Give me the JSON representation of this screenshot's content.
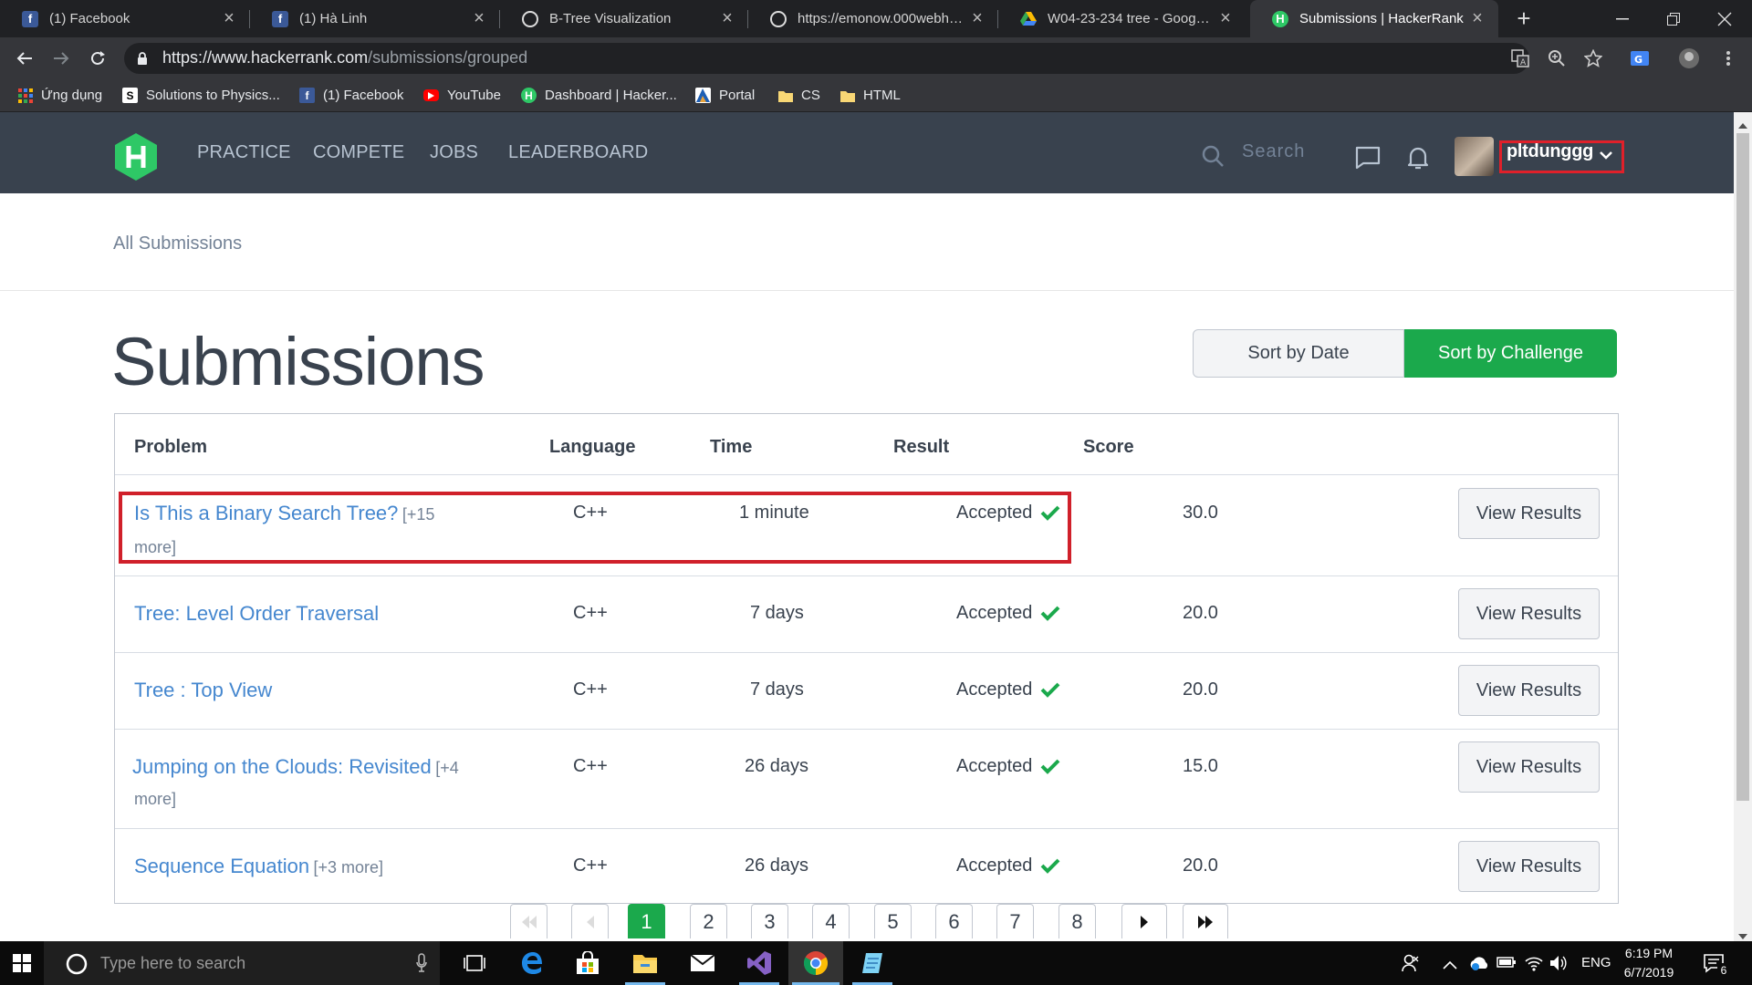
{
  "browser": {
    "tabs": [
      {
        "title": "(1) Facebook",
        "icon": "facebook-icon"
      },
      {
        "title": "(1) Hà Linh",
        "icon": "facebook-icon"
      },
      {
        "title": "B-Tree Visualization",
        "icon": "globe-icon"
      },
      {
        "title": "https://emonow.000webhost",
        "icon": "globe-icon"
      },
      {
        "title": "W04-23-234 tree - Google D",
        "icon": "google-drive-icon"
      },
      {
        "title": "Submissions | HackerRank",
        "icon": "hackerrank-icon",
        "active": true
      }
    ],
    "url_host": "https://www.hackerrank.com",
    "url_path": "/submissions/grouped",
    "bookmarks": [
      {
        "label": "Ứng dụng",
        "icon": "apps-grid-icon"
      },
      {
        "label": "Solutions to Physics...",
        "icon": "scribd-icon"
      },
      {
        "label": "(1) Facebook",
        "icon": "facebook-icon"
      },
      {
        "label": "YouTube",
        "icon": "youtube-icon"
      },
      {
        "label": "Dashboard | Hacker...",
        "icon": "hackerrank-icon"
      },
      {
        "label": "Portal",
        "icon": "portal-icon"
      },
      {
        "label": "CS",
        "icon": "folder-icon"
      },
      {
        "label": "HTML",
        "icon": "folder-icon"
      }
    ]
  },
  "nav": {
    "links": [
      "PRACTICE",
      "COMPETE",
      "JOBS",
      "LEADERBOARD"
    ],
    "search_placeholder": "Search",
    "username": "pltdunggg"
  },
  "breadcrumb": "All Submissions",
  "page_title": "Submissions",
  "sort": {
    "by_date": "Sort by Date",
    "by_challenge": "Sort by Challenge",
    "active": "by_challenge"
  },
  "table": {
    "headers": [
      "Problem",
      "Language",
      "Time",
      "Result",
      "Score"
    ],
    "rows": [
      {
        "problem": "Is This a Binary Search Tree?",
        "more_a": "[+15",
        "more_b": "more]",
        "language": "C++",
        "time": "1 minute",
        "result": "Accepted",
        "score": "30.0",
        "action": "View Results"
      },
      {
        "problem": "Tree: Level Order Traversal",
        "language": "C++",
        "time": "7 days",
        "result": "Accepted",
        "score": "20.0",
        "action": "View Results"
      },
      {
        "problem": "Tree : Top View",
        "language": "C++",
        "time": "7 days",
        "result": "Accepted",
        "score": "20.0",
        "action": "View Results"
      },
      {
        "problem": "Jumping on the Clouds: Revisited",
        "more_a": "[+4",
        "more_b": "more]",
        "language": "C++",
        "time": "26 days",
        "result": "Accepted",
        "score": "15.0",
        "action": "View Results"
      },
      {
        "problem": "Sequence Equation",
        "more_a": "[+3 more]",
        "language": "C++",
        "time": "26 days",
        "result": "Accepted",
        "score": "20.0",
        "action": "View Results"
      }
    ]
  },
  "pagination": {
    "pages": [
      "1",
      "2",
      "3",
      "4",
      "5",
      "6",
      "7",
      "8"
    ],
    "current": "1"
  },
  "taskbar": {
    "search_placeholder": "Type here to search",
    "language": "ENG",
    "time": "6:19 PM",
    "date": "6/7/2019",
    "notification_count": "6"
  },
  "colors": {
    "accent_green": "#1ba94c",
    "nav_bg": "#39424e",
    "link_blue": "#4587cf",
    "highlight_red": "#d0202a"
  }
}
